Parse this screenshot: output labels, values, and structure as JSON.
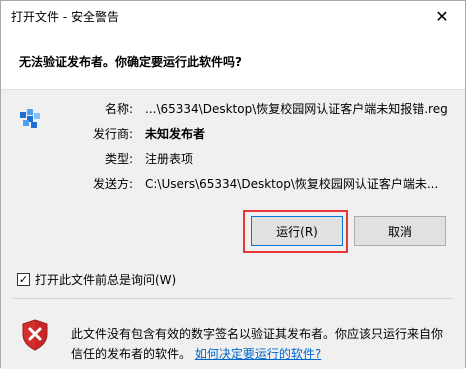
{
  "window": {
    "title": "打开文件 - 安全警告",
    "close_glyph": "✕"
  },
  "header": {
    "question": "无法验证发布者。你确定要运行此软件吗?"
  },
  "details": {
    "name_label": "名称:",
    "name_value": "...\\65334\\Desktop\\恢复校园网认证客户端未知报错.reg",
    "publisher_label": "发行商:",
    "publisher_value": "未知发布者",
    "type_label": "类型:",
    "type_value": "注册表项",
    "from_label": "发送方:",
    "from_value": "C:\\Users\\65334\\Desktop\\恢复校园网认证客户端未..."
  },
  "buttons": {
    "run_label": "运行(R)",
    "cancel_label": "取消"
  },
  "checkbox": {
    "label": "打开此文件前总是询问(W)",
    "checked": true,
    "check_glyph": "✓"
  },
  "warning": {
    "text": "此文件没有包含有效的数字签名以验证其发布者。你应该只运行来自你信任的发布者的软件。",
    "link": "如何决定要运行的软件?"
  },
  "icons": {
    "file": "registry-file-icon",
    "shield": "shield-error-icon"
  },
  "colors": {
    "accent": "#0078d7",
    "highlight": "#e53935",
    "link": "#0066cc",
    "shield_red": "#d32f2f"
  }
}
